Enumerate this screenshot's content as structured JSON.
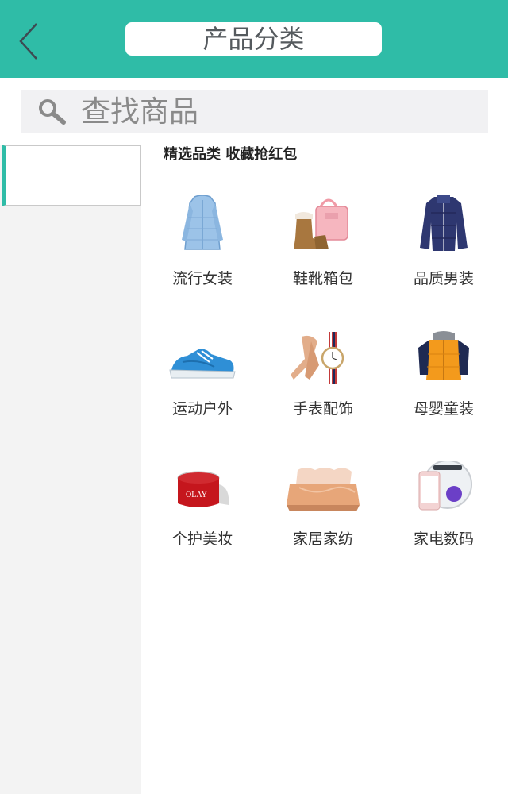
{
  "header": {
    "title": "产品分类"
  },
  "search": {
    "placeholder": "查找商品"
  },
  "sidebar": {
    "items": [
      {
        "label": ""
      }
    ]
  },
  "main": {
    "promo_text": "精选品类 收藏抢红包",
    "categories": [
      {
        "label": "流行女装",
        "icon": "womens-coat-icon"
      },
      {
        "label": "鞋靴箱包",
        "icon": "shoes-bag-icon"
      },
      {
        "label": "品质男装",
        "icon": "mens-jacket-icon"
      },
      {
        "label": "运动户外",
        "icon": "sneaker-icon"
      },
      {
        "label": "手表配饰",
        "icon": "watch-scarf-icon"
      },
      {
        "label": "母婴童装",
        "icon": "kids-jacket-icon"
      },
      {
        "label": "个护美妆",
        "icon": "cream-jar-icon"
      },
      {
        "label": "家居家纺",
        "icon": "bedding-icon"
      },
      {
        "label": "家电数码",
        "icon": "phone-robot-icon"
      }
    ]
  },
  "colors": {
    "accent": "#2fbca7",
    "sidebar_bg": "#f3f3f3",
    "search_bg": "#f1f1f3"
  }
}
